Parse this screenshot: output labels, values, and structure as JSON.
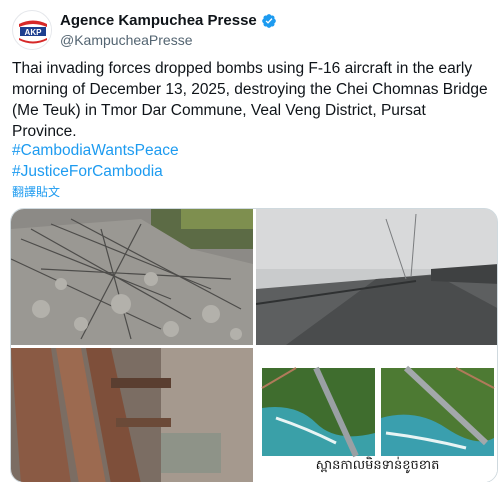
{
  "tweet": {
    "author": {
      "display_name": "Agence Kampuchea Presse",
      "handle": "@KampucheaPresse",
      "avatar_icon": "akp-logo-icon",
      "verified_icon": "verified-badge-icon",
      "verified_color": "#1d9bf0"
    },
    "text": "Thai invading forces dropped bombs using F-16 aircraft in the early morning of December 13, 2025, destroying the Chei Chomnas Bridge (Me Teuk) in Tmor Dar Commune, Veal Veng District, Pursat Province.",
    "hashtags": [
      "#CambodiaWantsPeace",
      "#JusticeForCambodia"
    ],
    "translate_label": "翻譯貼文",
    "media": {
      "images": [
        {
          "name": "debris-photo"
        },
        {
          "name": "foggy-bridge-photo"
        },
        {
          "name": "steel-beams-photo"
        },
        {
          "name": "aerial-bridge-before-after"
        }
      ],
      "caption_khmer": "ស្ពានកាលមិនទាន់ខូចខាត"
    },
    "colors": {
      "link": "#1d9bf0",
      "text": "#0f1419",
      "muted": "#536471"
    }
  }
}
